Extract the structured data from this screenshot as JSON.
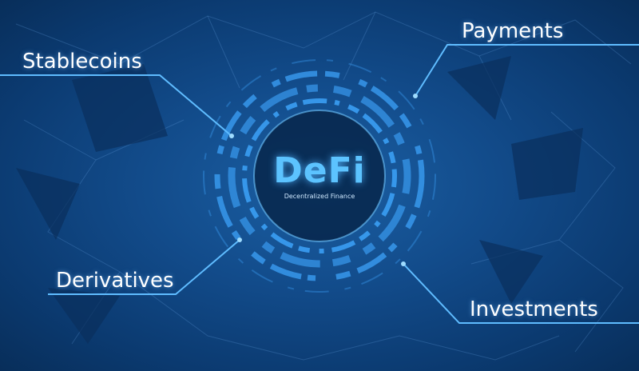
{
  "center": {
    "title": "DeFi",
    "subtitle": "Decentralized Finance"
  },
  "labels": {
    "top_left": "Stablecoins",
    "top_right": "Payments",
    "bottom_left": "Derivatives",
    "bottom_right": "Investments"
  },
  "colors": {
    "background": "#124b8a",
    "accent": "#4fb8ff",
    "text": "#ffffff"
  }
}
